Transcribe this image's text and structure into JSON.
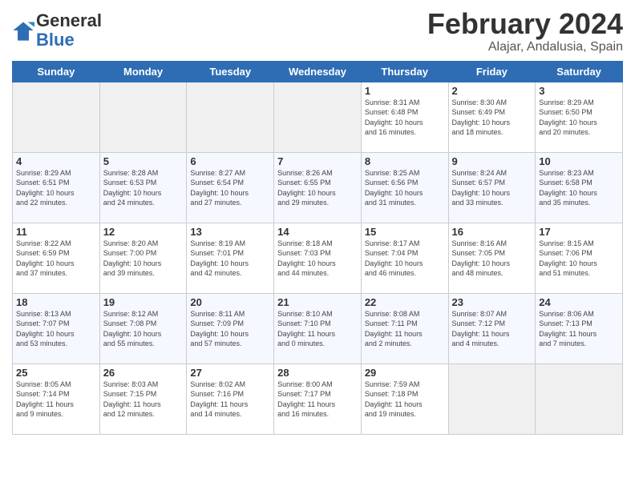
{
  "logo": {
    "general": "General",
    "blue": "Blue"
  },
  "header": {
    "title": "February 2024",
    "subtitle": "Alajar, Andalusia, Spain"
  },
  "days_of_week": [
    "Sunday",
    "Monday",
    "Tuesday",
    "Wednesday",
    "Thursday",
    "Friday",
    "Saturday"
  ],
  "weeks": [
    [
      {
        "day": "",
        "info": ""
      },
      {
        "day": "",
        "info": ""
      },
      {
        "day": "",
        "info": ""
      },
      {
        "day": "",
        "info": ""
      },
      {
        "day": "1",
        "info": "Sunrise: 8:31 AM\nSunset: 6:48 PM\nDaylight: 10 hours\nand 16 minutes."
      },
      {
        "day": "2",
        "info": "Sunrise: 8:30 AM\nSunset: 6:49 PM\nDaylight: 10 hours\nand 18 minutes."
      },
      {
        "day": "3",
        "info": "Sunrise: 8:29 AM\nSunset: 6:50 PM\nDaylight: 10 hours\nand 20 minutes."
      }
    ],
    [
      {
        "day": "4",
        "info": "Sunrise: 8:29 AM\nSunset: 6:51 PM\nDaylight: 10 hours\nand 22 minutes."
      },
      {
        "day": "5",
        "info": "Sunrise: 8:28 AM\nSunset: 6:53 PM\nDaylight: 10 hours\nand 24 minutes."
      },
      {
        "day": "6",
        "info": "Sunrise: 8:27 AM\nSunset: 6:54 PM\nDaylight: 10 hours\nand 27 minutes."
      },
      {
        "day": "7",
        "info": "Sunrise: 8:26 AM\nSunset: 6:55 PM\nDaylight: 10 hours\nand 29 minutes."
      },
      {
        "day": "8",
        "info": "Sunrise: 8:25 AM\nSunset: 6:56 PM\nDaylight: 10 hours\nand 31 minutes."
      },
      {
        "day": "9",
        "info": "Sunrise: 8:24 AM\nSunset: 6:57 PM\nDaylight: 10 hours\nand 33 minutes."
      },
      {
        "day": "10",
        "info": "Sunrise: 8:23 AM\nSunset: 6:58 PM\nDaylight: 10 hours\nand 35 minutes."
      }
    ],
    [
      {
        "day": "11",
        "info": "Sunrise: 8:22 AM\nSunset: 6:59 PM\nDaylight: 10 hours\nand 37 minutes."
      },
      {
        "day": "12",
        "info": "Sunrise: 8:20 AM\nSunset: 7:00 PM\nDaylight: 10 hours\nand 39 minutes."
      },
      {
        "day": "13",
        "info": "Sunrise: 8:19 AM\nSunset: 7:01 PM\nDaylight: 10 hours\nand 42 minutes."
      },
      {
        "day": "14",
        "info": "Sunrise: 8:18 AM\nSunset: 7:03 PM\nDaylight: 10 hours\nand 44 minutes."
      },
      {
        "day": "15",
        "info": "Sunrise: 8:17 AM\nSunset: 7:04 PM\nDaylight: 10 hours\nand 46 minutes."
      },
      {
        "day": "16",
        "info": "Sunrise: 8:16 AM\nSunset: 7:05 PM\nDaylight: 10 hours\nand 48 minutes."
      },
      {
        "day": "17",
        "info": "Sunrise: 8:15 AM\nSunset: 7:06 PM\nDaylight: 10 hours\nand 51 minutes."
      }
    ],
    [
      {
        "day": "18",
        "info": "Sunrise: 8:13 AM\nSunset: 7:07 PM\nDaylight: 10 hours\nand 53 minutes."
      },
      {
        "day": "19",
        "info": "Sunrise: 8:12 AM\nSunset: 7:08 PM\nDaylight: 10 hours\nand 55 minutes."
      },
      {
        "day": "20",
        "info": "Sunrise: 8:11 AM\nSunset: 7:09 PM\nDaylight: 10 hours\nand 57 minutes."
      },
      {
        "day": "21",
        "info": "Sunrise: 8:10 AM\nSunset: 7:10 PM\nDaylight: 11 hours\nand 0 minutes."
      },
      {
        "day": "22",
        "info": "Sunrise: 8:08 AM\nSunset: 7:11 PM\nDaylight: 11 hours\nand 2 minutes."
      },
      {
        "day": "23",
        "info": "Sunrise: 8:07 AM\nSunset: 7:12 PM\nDaylight: 11 hours\nand 4 minutes."
      },
      {
        "day": "24",
        "info": "Sunrise: 8:06 AM\nSunset: 7:13 PM\nDaylight: 11 hours\nand 7 minutes."
      }
    ],
    [
      {
        "day": "25",
        "info": "Sunrise: 8:05 AM\nSunset: 7:14 PM\nDaylight: 11 hours\nand 9 minutes."
      },
      {
        "day": "26",
        "info": "Sunrise: 8:03 AM\nSunset: 7:15 PM\nDaylight: 11 hours\nand 12 minutes."
      },
      {
        "day": "27",
        "info": "Sunrise: 8:02 AM\nSunset: 7:16 PM\nDaylight: 11 hours\nand 14 minutes."
      },
      {
        "day": "28",
        "info": "Sunrise: 8:00 AM\nSunset: 7:17 PM\nDaylight: 11 hours\nand 16 minutes."
      },
      {
        "day": "29",
        "info": "Sunrise: 7:59 AM\nSunset: 7:18 PM\nDaylight: 11 hours\nand 19 minutes."
      },
      {
        "day": "",
        "info": ""
      },
      {
        "day": "",
        "info": ""
      }
    ]
  ]
}
